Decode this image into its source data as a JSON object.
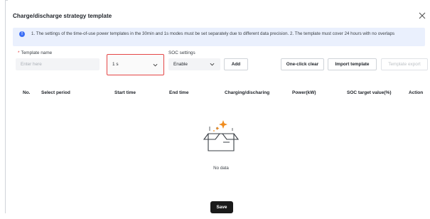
{
  "dialog": {
    "title": "Charge/discharge strategy template"
  },
  "notice": {
    "text": "1. The settings of the time-of-use power templates in the 30min and 1s modes must be set separately due to different data precision. 2. The template must cover 24 hours with no overlaps"
  },
  "form": {
    "template_name_label": "Template name",
    "required_mark": "*",
    "template_name_placeholder": "Enter here",
    "mode_value": "1 s",
    "soc_settings_label": "SOC settings",
    "soc_value": "Enable",
    "add_label": "Add"
  },
  "toolbar": {
    "clear_label": "One-click clear",
    "import_label": "Import template",
    "export_label": "Template export"
  },
  "table": {
    "columns": [
      "No.",
      "Select period",
      "Start time",
      "End time",
      "Charging/discharing",
      "Power(kW)",
      "SOC target value(%)",
      "Action"
    ],
    "rows": [],
    "empty_text": "No data"
  },
  "footer": {
    "save_label": "Save"
  },
  "colors": {
    "accent": "#3b6ef5",
    "highlight_border": "#e54646",
    "required": "#e23c3c",
    "empty_star": "#f08c1e"
  }
}
